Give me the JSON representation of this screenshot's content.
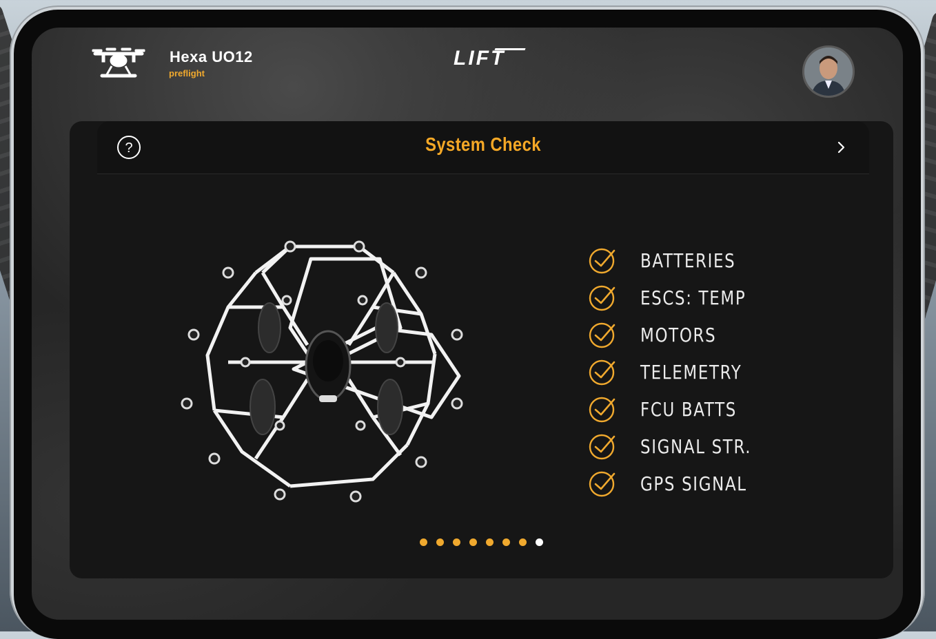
{
  "header": {
    "model_name": "Hexa UO12",
    "model_status": "preflight",
    "logo": "LIFT",
    "avatar": "user-avatar"
  },
  "panel": {
    "title": "System Check",
    "help_icon": "question-circle-icon",
    "next_icon": "chevron-right-icon",
    "checklist": [
      {
        "label": "BATTERIES",
        "status": "ok"
      },
      {
        "label": "ESCS: TEMP",
        "status": "ok"
      },
      {
        "label": "MOTORS",
        "status": "ok"
      },
      {
        "label": "TELEMETRY",
        "status": "ok"
      },
      {
        "label": "FCU BATTS",
        "status": "ok"
      },
      {
        "label": "SIGNAL STR.",
        "status": "ok"
      },
      {
        "label": "GPS SIGNAL",
        "status": "ok"
      }
    ],
    "pager": {
      "total": 8,
      "current": 8
    }
  },
  "colors": {
    "accent": "#f0a92e",
    "panel_bg": "#161616",
    "text": "#ececec"
  }
}
